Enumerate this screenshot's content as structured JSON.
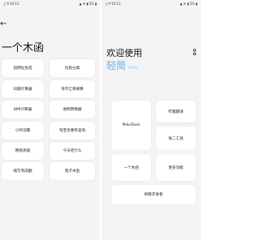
{
  "left": {
    "status": {
      "time": "上午10:11",
      "icons": "▲ ✉ ▮ 5G ▮"
    },
    "back_icon": "←",
    "title": "一个木函",
    "tools": [
      "短网址生成",
      "垃圾分类",
      "日期计算器",
      "货币汇率换算",
      "BMI计算器",
      "进制转换器",
      "小鸡词典",
      "淘宝优惠券查询",
      "网络测速",
      "今天吃什么",
      "缩写有成翻",
      "电子木鱼"
    ]
  },
  "right": {
    "status": {
      "time": "上午10:11",
      "icons": "▲ ✉ ▮ 5G ▮"
    },
    "welcome": "欢迎使用",
    "brand": "轻简",
    "brand_suffix": "Tools",
    "cards": {
      "miku": "MikuTools",
      "bilibili": "哔哩翻译",
      "anime": "兔二工具",
      "muhan": "一个木函",
      "more": "更多功能",
      "support": "捐赠开发者"
    }
  }
}
